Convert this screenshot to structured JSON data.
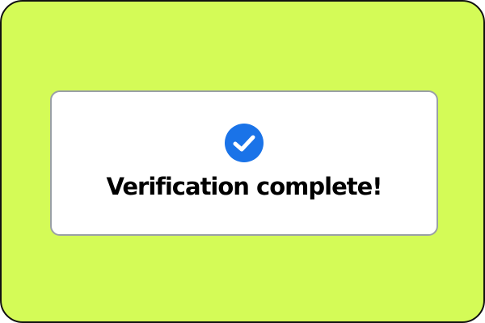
{
  "background_color": "#d4fb57",
  "accent_color": "#1a73e8",
  "card": {
    "icon": "check-circle-icon",
    "message": "Verification complete!"
  }
}
